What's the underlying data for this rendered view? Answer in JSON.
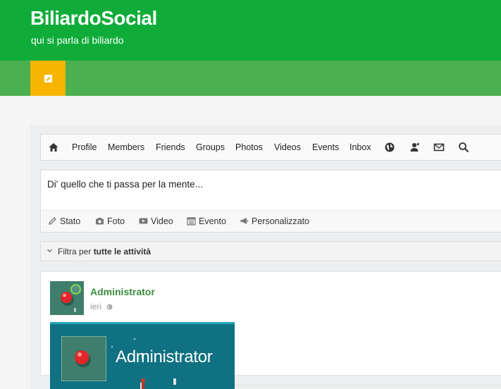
{
  "site": {
    "title": "BiliardoSocial",
    "tagline": "qui si parla di biliardo",
    "colors": {
      "header": "#0fac3a",
      "menubar": "#4caf50",
      "toggle": "#f7b500",
      "author": "#3a8d3b"
    }
  },
  "menu": {
    "toggle_icon": "expand-icon"
  },
  "nav": {
    "home_icon": "home-icon",
    "items": [
      "Profile",
      "Members",
      "Friends",
      "Groups",
      "Photos",
      "Videos",
      "Events",
      "Inbox"
    ],
    "icons": [
      "globe-icon",
      "user-add-icon",
      "mail-icon",
      "search-icon"
    ]
  },
  "composer": {
    "placeholder": "Di' quello che ti passa per la mente...",
    "types": [
      "Stato",
      "Foto",
      "Video",
      "Evento",
      "Personalizzato"
    ]
  },
  "filter": {
    "prefix": "Filtra per",
    "value": "tutte le attività"
  },
  "post": {
    "author": "Administrator",
    "time": "ieri",
    "privacy_icon": "globe-icon"
  },
  "hovercard": {
    "name": "Administrator"
  }
}
